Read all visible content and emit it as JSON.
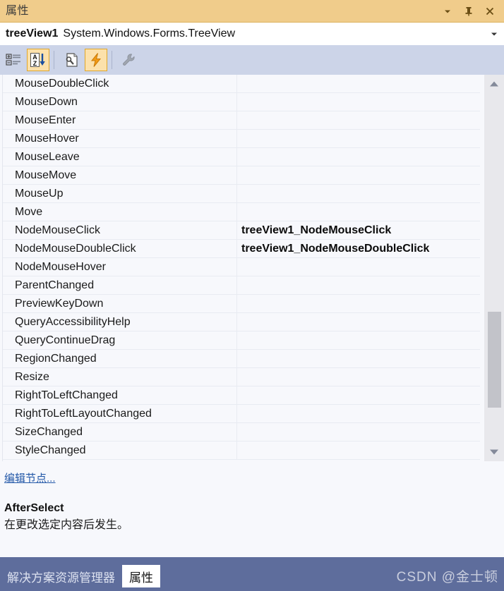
{
  "window": {
    "title": "属性",
    "buttons": [
      {
        "name": "dropdown",
        "icon": "chevron-down-icon"
      },
      {
        "name": "pin",
        "icon": "pin-icon"
      },
      {
        "name": "close",
        "icon": "close-icon"
      }
    ]
  },
  "object_selector": {
    "name": "treeView1",
    "type": "System.Windows.Forms.TreeView",
    "caret_icon": "chevron-down-icon"
  },
  "toolbar": {
    "items": [
      {
        "name": "categorized-view",
        "icon": "categorized-icon",
        "active": false,
        "tooltip": "分类"
      },
      {
        "name": "alphabetical-view",
        "icon": "sort-az-icon",
        "active": true,
        "tooltip": "字母"
      },
      {
        "name": "properties-view",
        "icon": "properties-page-icon",
        "active": false,
        "tooltip": "属性"
      },
      {
        "name": "events-view",
        "icon": "events-lightning-icon",
        "active": true,
        "tooltip": "事件"
      },
      {
        "name": "property-pages",
        "icon": "wrench-icon",
        "active": false,
        "tooltip": "属性页"
      }
    ]
  },
  "grid": {
    "rows": [
      {
        "name": "MouseDoubleClick",
        "value": ""
      },
      {
        "name": "MouseDown",
        "value": ""
      },
      {
        "name": "MouseEnter",
        "value": ""
      },
      {
        "name": "MouseHover",
        "value": ""
      },
      {
        "name": "MouseLeave",
        "value": ""
      },
      {
        "name": "MouseMove",
        "value": ""
      },
      {
        "name": "MouseUp",
        "value": ""
      },
      {
        "name": "Move",
        "value": ""
      },
      {
        "name": "NodeMouseClick",
        "value": "treeView1_NodeMouseClick"
      },
      {
        "name": "NodeMouseDoubleClick",
        "value": "treeView1_NodeMouseDoubleClick"
      },
      {
        "name": "NodeMouseHover",
        "value": ""
      },
      {
        "name": "ParentChanged",
        "value": ""
      },
      {
        "name": "PreviewKeyDown",
        "value": ""
      },
      {
        "name": "QueryAccessibilityHelp",
        "value": ""
      },
      {
        "name": "QueryContinueDrag",
        "value": ""
      },
      {
        "name": "RegionChanged",
        "value": ""
      },
      {
        "name": "Resize",
        "value": ""
      },
      {
        "name": "RightToLeftChanged",
        "value": ""
      },
      {
        "name": "RightToLeftLayoutChanged",
        "value": ""
      },
      {
        "name": "SizeChanged",
        "value": ""
      },
      {
        "name": "StyleChanged",
        "value": ""
      }
    ],
    "scrollbar": {
      "up_icon": "triangle-up-icon",
      "down_icon": "triangle-down-icon"
    }
  },
  "link_panel": {
    "edit_nodes_label": "编辑节点..."
  },
  "description": {
    "title": "AfterSelect",
    "body": "在更改选定内容后发生。"
  },
  "tab_bar": {
    "tabs": [
      {
        "label": "解决方案资源管理器",
        "active": false
      },
      {
        "label": "属性",
        "active": true
      }
    ],
    "watermark": "CSDN @金士顿"
  },
  "colors": {
    "titlebar_bg": "#f0cc8b",
    "toolbar_bg": "#ccd4e8",
    "grid_bg": "#f7f8fc",
    "tabbar_bg": "#5e6d9c",
    "link_color": "#2358a8",
    "active_tool_bg": "#fce1ab"
  }
}
